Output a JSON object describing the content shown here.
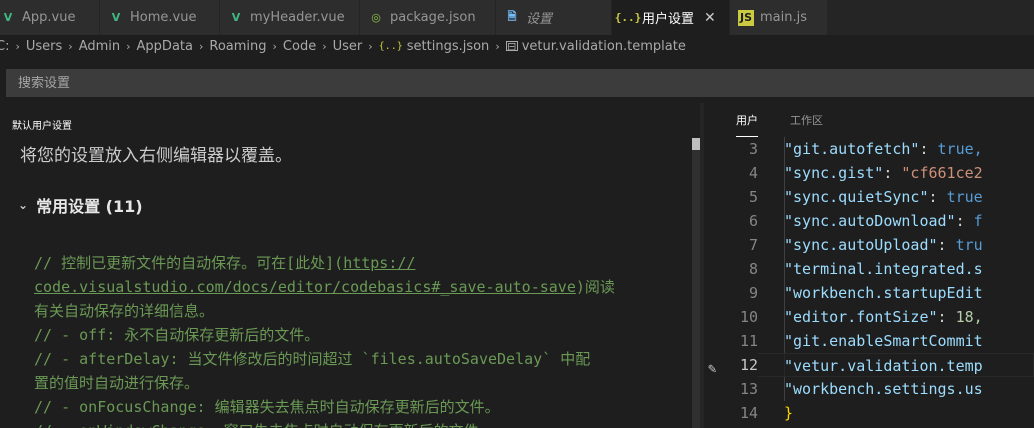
{
  "tabs": [
    {
      "label": "App.vue",
      "icon": "vue-icon",
      "glyph": "V"
    },
    {
      "label": "Home.vue",
      "icon": "vue-icon",
      "glyph": "V"
    },
    {
      "label": "myHeader.vue",
      "icon": "vue-icon",
      "glyph": "V"
    },
    {
      "label": "package.json",
      "icon": "npm-package-icon",
      "glyph": "◎"
    },
    {
      "label": "设置",
      "icon": "file-icon",
      "glyph": "🗎"
    },
    {
      "label": "用户设置",
      "icon": "json-icon",
      "glyph": "{..}",
      "close": "✕"
    },
    {
      "label": "main.js",
      "icon": "js-icon",
      "glyph": "JS"
    }
  ],
  "breadcrumb": {
    "items": [
      "C:",
      "Users",
      "Admin",
      "AppData",
      "Roaming",
      "Code",
      "User"
    ],
    "file": "settings.json",
    "file_icon": "{..}",
    "property": "vetur.validation.template",
    "property_icon": "⊟",
    "separator": "›"
  },
  "search": {
    "placeholder": "搜索设置"
  },
  "left": {
    "header": "默认用户设置",
    "hint": "将您的设置放入右侧编辑器以覆盖。",
    "section_title": "常用设置 (11)",
    "chevron": "⌄",
    "comment_lines": [
      {
        "pre": "// 控制已更新文件的自动保存。可在[此处](",
        "link": "https://",
        "post": ""
      },
      {
        "pre": "",
        "link": "code.visualstudio.com/docs/editor/codebasics#_save-auto-save",
        "post": ")阅读"
      },
      {
        "pre": "有关自动保存的详细信息。",
        "link": "",
        "post": ""
      },
      {
        "pre": "//  - off: 永不自动保存更新后的文件。",
        "link": "",
        "post": ""
      },
      {
        "pre": "//  - afterDelay: 当文件修改后的时间超过 `files.autoSaveDelay` 中配",
        "link": "",
        "post": ""
      },
      {
        "pre": "置的值时自动进行保存。",
        "link": "",
        "post": ""
      },
      {
        "pre": "//  - onFocusChange: 编辑器失去焦点时自动保存更新后的文件。",
        "link": "",
        "post": ""
      },
      {
        "pre": "//  - onWindowChange: 窗口失去焦点时自动保存更新后的文件。",
        "link": "",
        "post": ""
      }
    ]
  },
  "right": {
    "tabs": [
      "用户",
      "工作区"
    ],
    "pencil": "✎",
    "lines": [
      {
        "n": "3",
        "key": "\"git.autofetch\"",
        "sep": ": ",
        "val": "true,",
        "vt": "bool"
      },
      {
        "n": "4",
        "key": "\"sync.gist\"",
        "sep": ": ",
        "val": "\"cf661ce2",
        "vt": "str"
      },
      {
        "n": "5",
        "key": "\"sync.quietSync\"",
        "sep": ": ",
        "val": "true",
        "vt": "bool"
      },
      {
        "n": "6",
        "key": "\"sync.autoDownload\"",
        "sep": ": ",
        "val": "f",
        "vt": "bool"
      },
      {
        "n": "7",
        "key": "\"sync.autoUpload\"",
        "sep": ": ",
        "val": "tru",
        "vt": "bool"
      },
      {
        "n": "8",
        "key": "\"terminal.integrated.s",
        "sep": "",
        "val": "",
        "vt": "pun"
      },
      {
        "n": "9",
        "key": "\"workbench.startupEdit",
        "sep": "",
        "val": "",
        "vt": "pun"
      },
      {
        "n": "10",
        "key": "\"editor.fontSize\"",
        "sep": ": ",
        "val": "18,",
        "vt": "num"
      },
      {
        "n": "11",
        "key": "\"git.enableSmartCommit",
        "sep": "",
        "val": "",
        "vt": "pun"
      },
      {
        "n": "12",
        "key": "\"vetur.validation.temp",
        "sep": "",
        "val": "",
        "vt": "pun"
      },
      {
        "n": "13",
        "key": "\"workbench.settings.us",
        "sep": "",
        "val": "",
        "vt": "pun"
      },
      {
        "n": "14",
        "key": "}",
        "sep": "",
        "val": "",
        "vt": "pun"
      }
    ]
  }
}
